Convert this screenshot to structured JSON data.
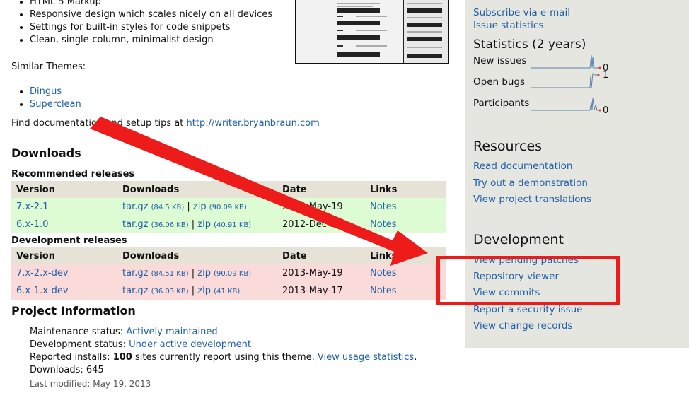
{
  "features": [
    "HTML 5 Markup",
    "Responsive design which scales nicely on all devices",
    "Settings for built-in styles for code snippets",
    "Clean, single-column, minimalist design"
  ],
  "similar_label": "Similar Themes:",
  "similar_themes": [
    "Dingus",
    "Superclean"
  ],
  "docs": {
    "prefix": "Find documentation and setup tips at",
    "link": "http://writer.bryanbraun.com"
  },
  "downloads_heading": "Downloads",
  "recommended": {
    "heading": "Recommended releases",
    "columns": [
      "Version",
      "Downloads",
      "Date",
      "Links"
    ],
    "rows": [
      {
        "version": "7.x-2.1",
        "targz": "tar.gz",
        "targz_size": "(84.5 KB)",
        "sep": "|",
        "zip": "zip",
        "zip_size": "(90.09 KB)",
        "date": "2013-May-19",
        "notes": "Notes"
      },
      {
        "version": "6.x-1.0",
        "targz": "tar.gz",
        "targz_size": "(36.06 KB)",
        "sep": "|",
        "zip": "zip",
        "zip_size": "(40.91 KB)",
        "date": "2012-Dec-31",
        "notes": "Notes"
      }
    ]
  },
  "development": {
    "heading": "Development releases",
    "columns": [
      "Version",
      "Downloads",
      "Date",
      "Links"
    ],
    "rows": [
      {
        "version": "7.x-2.x-dev",
        "targz": "tar.gz",
        "targz_size": "(84.51 KB)",
        "sep": "|",
        "zip": "zip",
        "zip_size": "(90.09 KB)",
        "date": "2013-May-19",
        "notes": "Notes"
      },
      {
        "version": "6.x-1.x-dev",
        "targz": "tar.gz",
        "targz_size": "(36.03 KB)",
        "sep": "|",
        "zip": "zip",
        "zip_size": "(41 KB)",
        "date": "2013-May-17",
        "notes": "Notes"
      }
    ]
  },
  "project_info": {
    "heading": "Project Information",
    "maintenance_label": "Maintenance status:",
    "maintenance_value": "Actively maintained",
    "development_label": "Development status:",
    "development_value": "Under active development",
    "installs_prefix": "Reported installs:",
    "installs_count": "100",
    "installs_suffix": "sites currently report using this theme.",
    "installs_link": "View usage statistics",
    "installs_end": ".",
    "downloads": "Downloads: 645",
    "last_modified": "Last modified: May 19, 2013"
  },
  "sidebar": {
    "links_top": [
      "Subscribe via e-mail",
      "Issue statistics"
    ],
    "statistics_heading": "Statistics (2 years)",
    "stats": [
      {
        "label": "New issues",
        "value": "0"
      },
      {
        "label": "Open bugs",
        "value": "1"
      },
      {
        "label": "Participants",
        "value": "0"
      }
    ],
    "resources_heading": "Resources",
    "resources": [
      "Read documentation",
      "Try out a demonstration",
      "View project translations"
    ],
    "development_heading": "Development",
    "development_links": [
      "View pending patches",
      "Repository viewer",
      "View commits",
      "Report a security issue",
      "View change records"
    ]
  },
  "colors": {
    "link": "#1f5fa8",
    "annotation": "#ee1b1b",
    "recommended_row": "#ddfcd4",
    "development_row": "#fbdada",
    "header_row": "#e6e2d6",
    "sidebar_bg": "#e6e6e1"
  }
}
